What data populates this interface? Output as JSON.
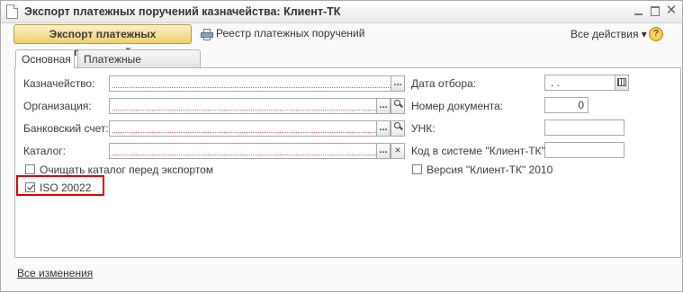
{
  "window": {
    "title": "Экспорт платежных поручений казначейства: Клиент-ТК"
  },
  "toolbar": {
    "main_action": "Экспорт платежных поручений",
    "registry": "Реестр платежных поручений",
    "all_actions": "Все действия ▾",
    "help": "?"
  },
  "tabs": [
    {
      "label": "Основная",
      "active": true
    },
    {
      "label": "Платежные документы",
      "active": false
    }
  ],
  "left_fields": {
    "treasury": {
      "label": "Казначейство:",
      "value": ""
    },
    "organization": {
      "label": "Организация:",
      "value": ""
    },
    "bank_account": {
      "label": "Банковский счет:",
      "value": ""
    },
    "catalog": {
      "label": "Каталог:",
      "value": ""
    }
  },
  "right_fields": {
    "date": {
      "label": "Дата отбора:",
      "value": " .  ."
    },
    "doc_number": {
      "label": "Номер документа:",
      "value": "0"
    },
    "unk": {
      "label": "УНК:",
      "value": ""
    },
    "client_code": {
      "label": "Код в системе \"Клиент-ТК\":",
      "value": ""
    }
  },
  "checkboxes": {
    "clear_catalog": {
      "label": "Очищать каталог перед экспортом",
      "checked": false
    },
    "iso": {
      "label": "ISO 20022",
      "checked": true
    },
    "version_2010": {
      "label": "Версия \"Клиент-ТК\" 2010",
      "checked": false
    }
  },
  "field_icons": {
    "select": "...",
    "search": "search-icon",
    "clear": "×",
    "calendar": "calendar-icon"
  },
  "footer": {
    "all_changes": "Все изменения"
  },
  "colors": {
    "highlight": "#e00000",
    "main_action_bg": "#f0cf6e"
  }
}
